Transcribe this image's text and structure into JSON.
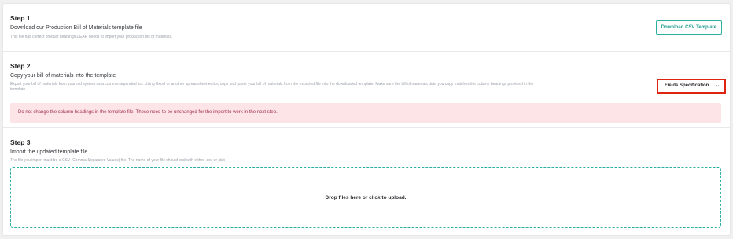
{
  "step1": {
    "title": "Step 1",
    "subtitle": "Download our Production Bill of Materials template file",
    "help": "This file has correct product headings DEAR needs to import your production bill of materials.",
    "download_button": "Download CSV Template"
  },
  "step2": {
    "title": "Step 2",
    "subtitle": "Copy your bill of materials into the template",
    "help_line1": "Export your bill of materials from your old system as a comma-separated list. Using Excel or another spreadsheet editor, copy and paste your bill of materials from the exported file into the downloaded template. Make sure the bill of materials data you copy matches the column headings provided in the",
    "help_line2": "template",
    "fields_button": "Fields Specification",
    "warning": "Do not change the column headings in the template file. These need to be unchanged for the import to work in the next step."
  },
  "step3": {
    "title": "Step 3",
    "subtitle": "Import the updated template file",
    "help": "The file you import must be a CSV (Comma-Separated Values) file. The name of your file should end with either .csv or .dat",
    "dropzone_label": "Drop files here or click to upload."
  },
  "icons": {
    "chevron": "chevron-down-icon"
  },
  "colors": {
    "accent": "#2bb0a0",
    "highlight": "#e02412",
    "warning_bg": "#fde4e6",
    "warning_text": "#a0314a"
  }
}
